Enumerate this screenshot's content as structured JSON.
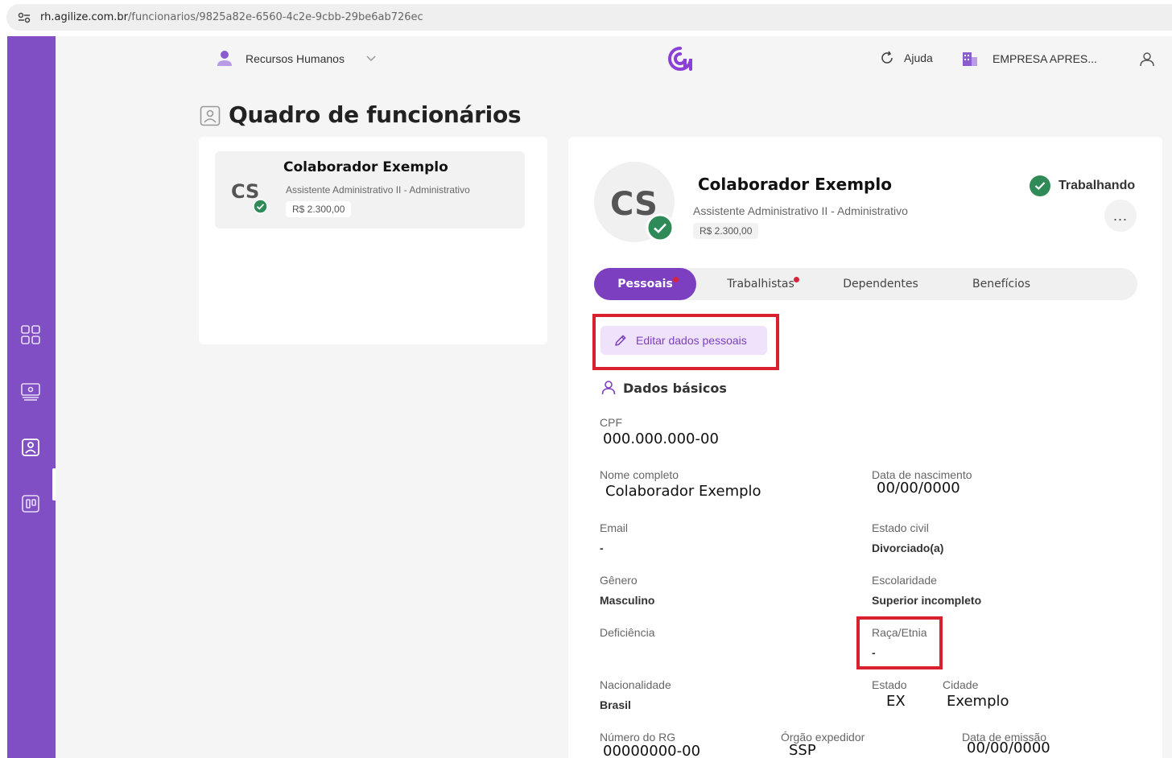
{
  "browser": {
    "url_host": "rh.agilize.com.br",
    "url_path": "/funcionarios/9825a82e-6560-4c2e-9cbb-29be6ab726ec"
  },
  "topbar": {
    "module_label": "Recursos Humanos",
    "help_label": "Ajuda",
    "company_label": "EMPRESA APRES..."
  },
  "page": {
    "title": "Quadro de funcionários"
  },
  "employee_card": {
    "initials": "CS",
    "name": "Colaborador Exemplo",
    "role": "Assistente Administrativo II - Administrativo",
    "salary": "R$ 2.300,00"
  },
  "profile": {
    "initials": "CS",
    "name": "Colaborador Exemplo",
    "role": "Assistente Administrativo II - Administrativo",
    "salary": "R$ 2.300,00",
    "status": "Trabalhando",
    "more": "..."
  },
  "tabs": [
    {
      "label": "Pessoais",
      "active": true,
      "alert": true
    },
    {
      "label": "Trabalhistas",
      "active": false,
      "alert": true
    },
    {
      "label": "Dependentes",
      "active": false,
      "alert": false
    },
    {
      "label": "Benefícios",
      "active": false,
      "alert": false
    }
  ],
  "edit_button": "Editar dados pessoais",
  "section": {
    "title": "Dados básicos"
  },
  "fields": {
    "cpf": {
      "label": "CPF",
      "value": "000.000.000-00"
    },
    "nome": {
      "label": "Nome completo",
      "value": "Colaborador Exemplo"
    },
    "nascimento": {
      "label": "Data de nascimento",
      "value": "00/00/0000"
    },
    "email": {
      "label": "Email",
      "value": "-"
    },
    "estado_civil": {
      "label": "Estado civil",
      "value": "Divorciado(a)"
    },
    "genero": {
      "label": "Gênero",
      "value": "Masculino"
    },
    "escolaridade": {
      "label": "Escolaridade",
      "value": "Superior incompleto"
    },
    "deficiencia": {
      "label": "Deficiência",
      "value": ""
    },
    "raca": {
      "label": "Raça/Etnia",
      "value": "-"
    },
    "nacionalidade": {
      "label": "Nacionalidade",
      "value": "Brasil"
    },
    "estado": {
      "label": "Estado",
      "value": "EX"
    },
    "cidade": {
      "label": "Cidade",
      "value": "Exemplo"
    },
    "rg": {
      "label": "Número do RG",
      "value": "00000000-00"
    },
    "orgao": {
      "label": "Órgão expedidor",
      "value": "SSP"
    },
    "emissao": {
      "label": "Data de emissão",
      "value": "00/00/0000"
    }
  },
  "colors": {
    "brand_purple": "#7c3fbf",
    "sidebar": "#7f4fc3",
    "success": "#2e8b57",
    "highlight_red": "#d8202e",
    "alert_dot": "#d6243a"
  }
}
